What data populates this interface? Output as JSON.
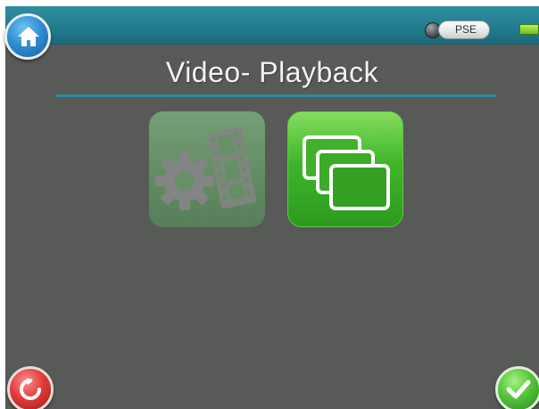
{
  "header": {
    "home_icon": "home-icon",
    "status_led": "status-led",
    "pse_label": "PSE",
    "battery_icon": "battery-icon"
  },
  "page": {
    "title": "Video- Playback"
  },
  "tiles": [
    {
      "name": "video-settings",
      "icon": "gear-film-icon",
      "enabled": false
    },
    {
      "name": "playback-files",
      "icon": "stacked-windows-icon",
      "enabled": true
    }
  ],
  "footer": {
    "reset_icon": "refresh-icon",
    "confirm_icon": "checkmark-icon"
  },
  "colors": {
    "topbar": "#237d8f",
    "background": "#575a57",
    "title_underline": "#2b8ea3",
    "tile_active": "#3fb52b",
    "tile_disabled": "#6a9a6a"
  }
}
